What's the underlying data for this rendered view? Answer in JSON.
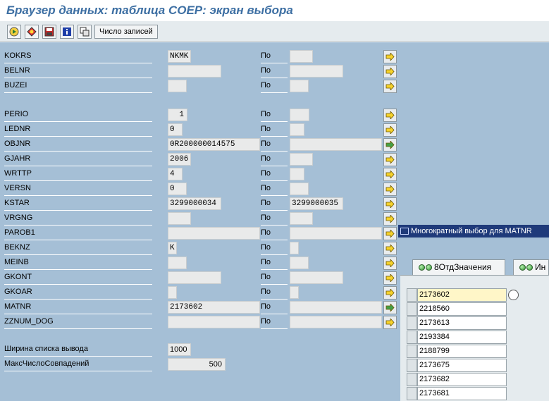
{
  "window": {
    "title": "Браузер данных: таблица COEP: экран выбора"
  },
  "toolbar": {
    "buttons": [
      {
        "icon": "execute-icon"
      },
      {
        "icon": "variants-icon"
      },
      {
        "icon": "save-icon"
      },
      {
        "icon": "info-icon"
      },
      {
        "icon": "copy-icon"
      }
    ],
    "count_label": "Число записей"
  },
  "po_label": "По",
  "fields": [
    {
      "name": "KOKRS",
      "from": "NKMK",
      "to": ""
    },
    {
      "name": "BELNR",
      "from": "",
      "to": ""
    },
    {
      "name": "BUZEI",
      "from": "",
      "to": ""
    },
    {
      "name": "PERIO",
      "from": "1",
      "to": ""
    },
    {
      "name": "LEDNR",
      "from": "0",
      "to": ""
    },
    {
      "name": "OBJNR",
      "from": "0R200000014575",
      "to": ""
    },
    {
      "name": "GJAHR",
      "from": "2006",
      "to": ""
    },
    {
      "name": "WRTTP",
      "from": "4",
      "to": ""
    },
    {
      "name": "VERSN",
      "from": "0",
      "to": ""
    },
    {
      "name": "KSTAR",
      "from": "3299000034",
      "to": "3299000035"
    },
    {
      "name": "VRGNG",
      "from": "",
      "to": ""
    },
    {
      "name": "PAROB1",
      "from": "",
      "to": ""
    },
    {
      "name": "BEKNZ",
      "from": "K",
      "to": ""
    },
    {
      "name": "MEINB",
      "from": "",
      "to": ""
    },
    {
      "name": "GKONT",
      "from": "",
      "to": ""
    },
    {
      "name": "GKOAR",
      "from": "",
      "to": ""
    },
    {
      "name": "MATNR",
      "from": "2173602",
      "to": ""
    },
    {
      "name": "ZZNUM_DOG",
      "from": "",
      "to": ""
    }
  ],
  "settings": [
    {
      "label": "Ширина списка вывода",
      "value": "1000"
    },
    {
      "label": "МаксЧислоСовпадений",
      "value": "500"
    }
  ],
  "popup": {
    "title": "Многократный выбор для MATNR",
    "tabs": [
      {
        "label": "8ОтдЗначения"
      },
      {
        "label": "Ин"
      }
    ],
    "values": [
      "2173602",
      "2218560",
      "2173613",
      "2193384",
      "2188799",
      "2173675",
      "2173682",
      "2173681"
    ]
  }
}
